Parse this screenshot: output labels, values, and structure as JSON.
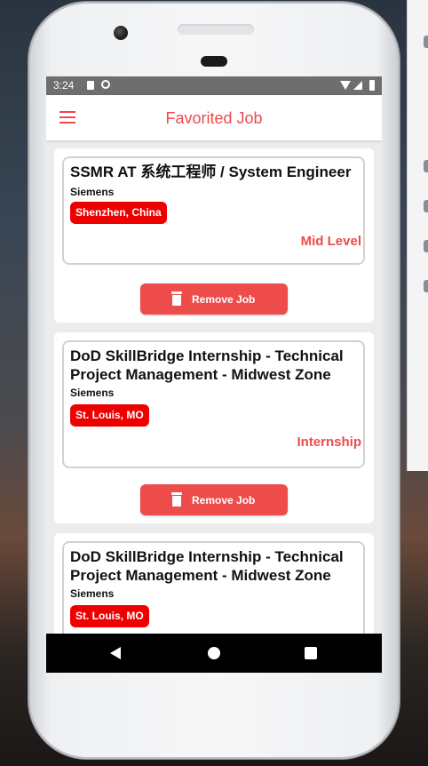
{
  "status_bar": {
    "time": "3:24"
  },
  "app_bar": {
    "title": "Favorited Job"
  },
  "jobs": [
    {
      "title": "SSMR AT 系统工程师 / System Engineer",
      "company": "Siemens",
      "location": "Shenzhen, China",
      "level": "Mid Level",
      "remove_label": "Remove Job"
    },
    {
      "title": "DoD SkillBridge Internship - Technical Project Management - Midwest Zone",
      "company": "Siemens",
      "location": "St. Louis, MO",
      "level": "Internship",
      "remove_label": "Remove Job"
    },
    {
      "title": "DoD SkillBridge Internship - Technical Project Management - Midwest Zone",
      "company": "Siemens",
      "location": "St. Louis, MO",
      "level": "",
      "remove_label": ""
    }
  ],
  "colors": {
    "accent": "#ee4b4b",
    "badge": "#ee0000",
    "status_bar": "#6e6e6e"
  }
}
